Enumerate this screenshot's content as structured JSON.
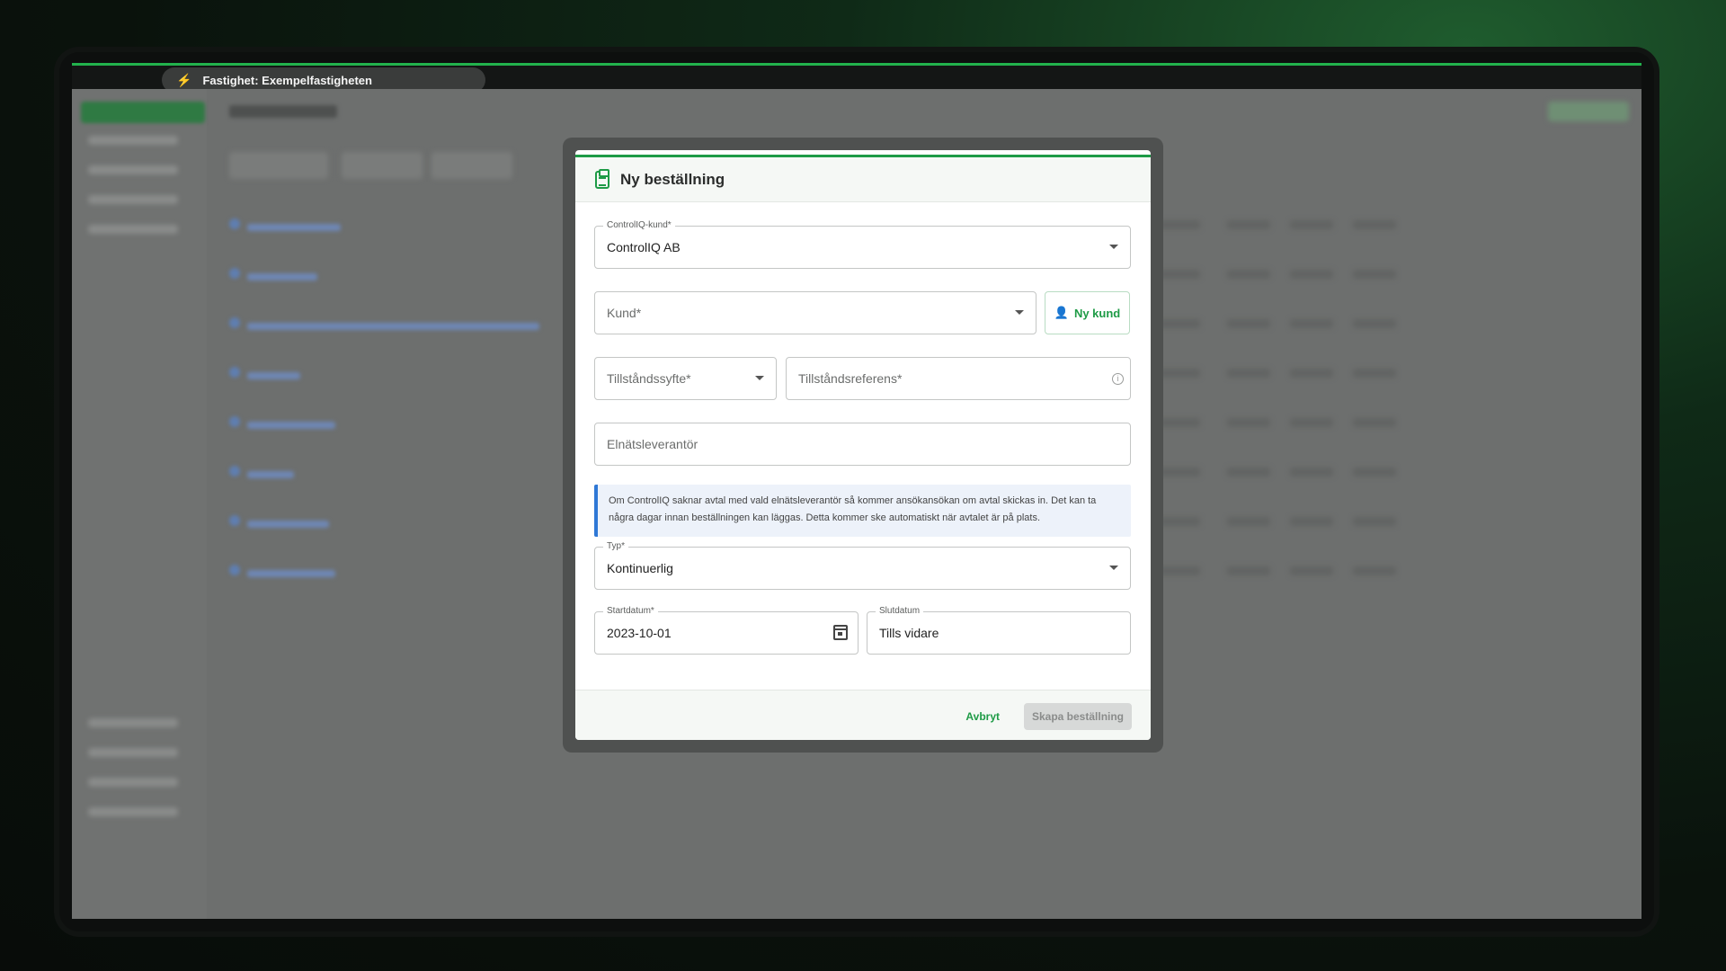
{
  "window": {
    "tab_title": "Fastighet: Exempelfastigheten"
  },
  "modal": {
    "title": "Ny beställning",
    "controliq_customer": {
      "label": "ControlIQ-kund*",
      "value": "ControlIQ AB"
    },
    "customer": {
      "placeholder": "Kund*"
    },
    "new_customer_button": "Ny kund",
    "permit_purpose": {
      "placeholder": "Tillståndssyfte*"
    },
    "permit_reference": {
      "placeholder": "Tillståndsreferens*"
    },
    "grid_supplier": {
      "placeholder": "Elnätsleverantör"
    },
    "info_text": "Om ControlIQ saknar avtal med vald elnätsleverantör så kommer ansökansökan om avtal skickas in. Det kan ta några dagar innan beställningen kan läggas. Detta kommer ske automatiskt när avtalet är på plats.",
    "type": {
      "label": "Typ*",
      "value": "Kontinuerlig"
    },
    "start_date": {
      "label": "Startdatum*",
      "value": "2023-10-01"
    },
    "end_date": {
      "label": "Slutdatum",
      "value": "Tills vidare"
    },
    "cancel_button": "Avbryt",
    "create_button": "Skapa beställning"
  }
}
